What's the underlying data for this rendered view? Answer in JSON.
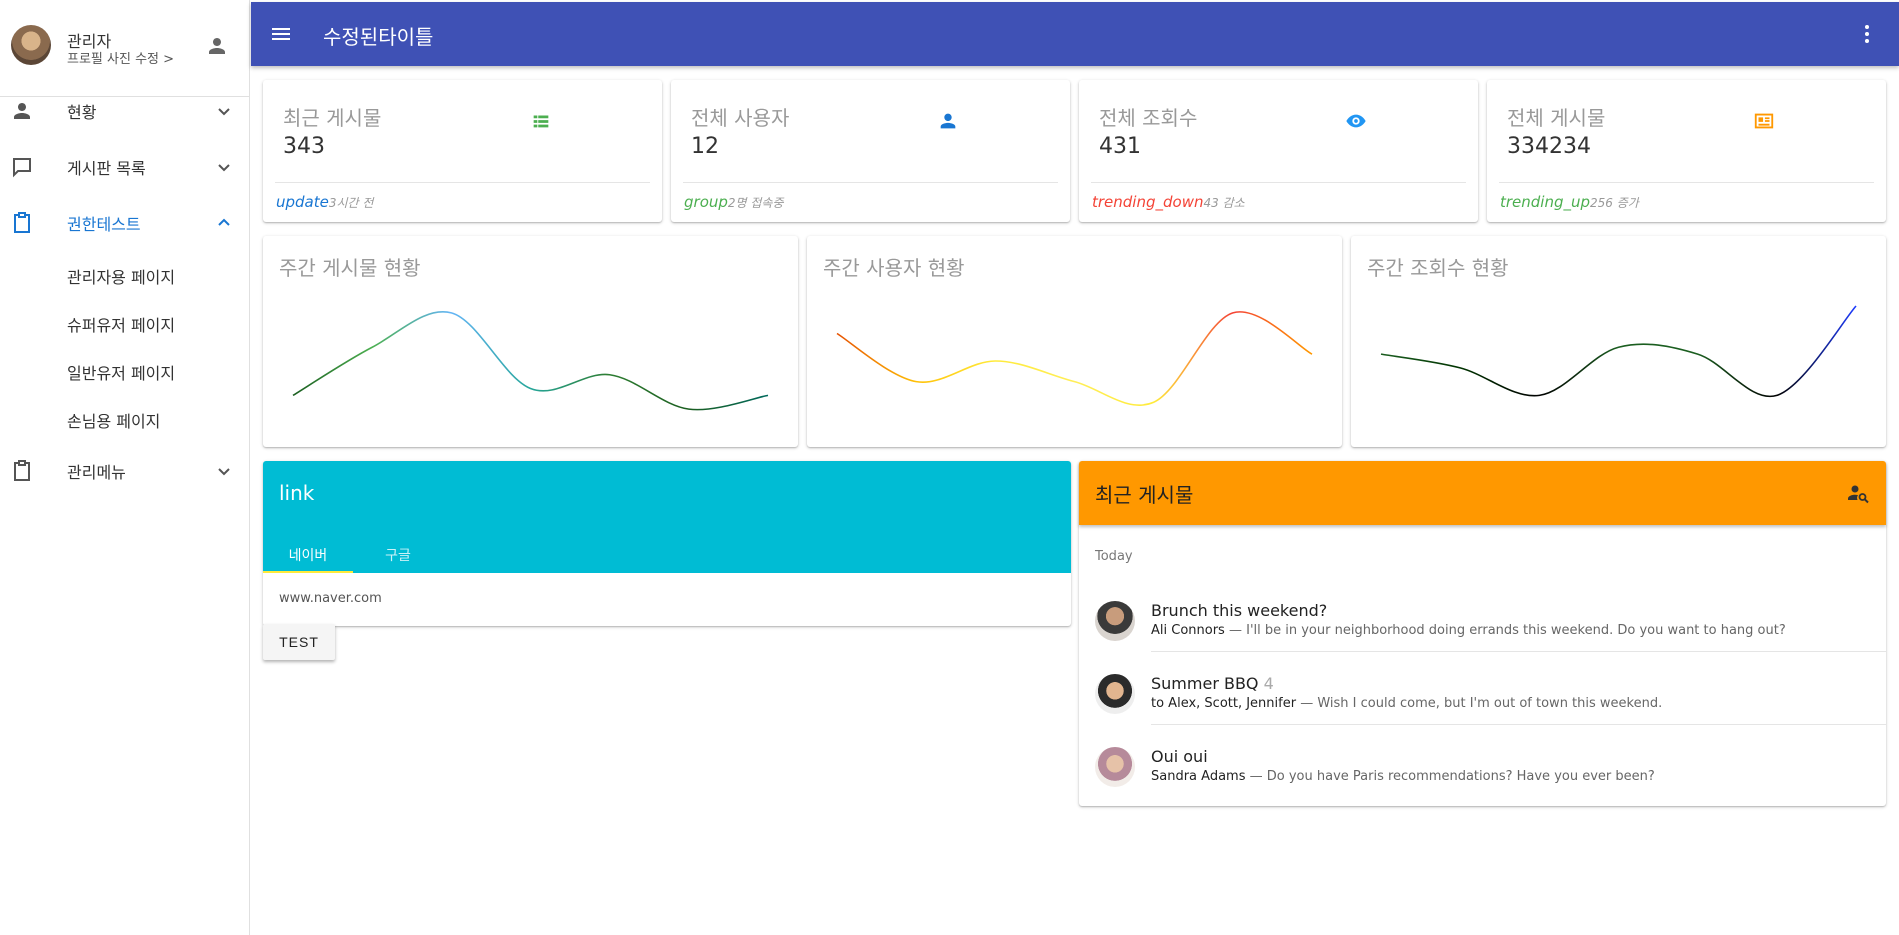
{
  "sidebar": {
    "profile": {
      "name": "관리자",
      "subtitle": "프로필 사진 수정 >"
    },
    "items": [
      {
        "label": "현황"
      },
      {
        "label": "게시판 목록"
      },
      {
        "label": "권한테스트"
      },
      {
        "label": "관리메뉴"
      }
    ],
    "sub_items": [
      {
        "label": "관리자용 페이지"
      },
      {
        "label": "슈퍼유저 페이지"
      },
      {
        "label": "일반유저 페이지"
      },
      {
        "label": "손님용 페이지"
      }
    ]
  },
  "header": {
    "title": "수정된타이틀"
  },
  "stats": [
    {
      "title": "최근 게시물",
      "value": "343",
      "foot_icon": "update",
      "foot_text": "3시간 전",
      "color": "#4caf50",
      "foot_color": "#1976d2",
      "icon": "list-icon"
    },
    {
      "title": "전체 사용자",
      "value": "12",
      "foot_icon": "group",
      "foot_text": "2명 접속중",
      "color": "#1976d2",
      "foot_color": "#4caf50",
      "icon": "person-icon"
    },
    {
      "title": "전체 조회수",
      "value": "431",
      "foot_icon": "trending_down",
      "foot_text": "43 감소",
      "color": "#2196f3",
      "foot_color": "#f44336",
      "icon": "eye-icon"
    },
    {
      "title": "전체 게시물",
      "value": "334234",
      "foot_icon": "trending_up",
      "foot_text": "256 증가",
      "color": "#ff9800",
      "foot_color": "#4caf50",
      "icon": "article-icon"
    }
  ],
  "charts": {
    "chart_data": [
      {
        "type": "line",
        "title": "주간 게시물 현황",
        "values": [
          3,
          10,
          15,
          4,
          6,
          1,
          3
        ],
        "ylim": [
          0,
          16
        ]
      },
      {
        "type": "line",
        "title": "주간 사용자 현황",
        "values": [
          12,
          5,
          8,
          5,
          2,
          15,
          9
        ],
        "ylim": [
          0,
          16
        ]
      },
      {
        "type": "line",
        "title": "주간 조회수 현황",
        "values": [
          9,
          7,
          3,
          10,
          9,
          3,
          16
        ],
        "ylim": [
          0,
          16
        ]
      }
    ]
  },
  "link_card": {
    "title": "link",
    "tabs": [
      {
        "label": "네이버"
      },
      {
        "label": "구글"
      }
    ],
    "url": "www.naver.com",
    "button": "TEST"
  },
  "posts": {
    "title": "최근 게시물",
    "section": "Today",
    "items": [
      {
        "title": "Brunch this weekend?",
        "count": "",
        "author": "Ali Connors",
        "text": " — I'll be in your neighborhood doing errands this weekend. Do you want to hang out?"
      },
      {
        "title": "Summer BBQ",
        "count": "4",
        "author": "to Alex, Scott, Jennifer",
        "text": " — Wish I could come, but I'm out of town this weekend."
      },
      {
        "title": "Oui oui",
        "count": "",
        "author": "Sandra Adams",
        "text": " — Do you have Paris recommendations? Have you ever been?"
      }
    ]
  }
}
